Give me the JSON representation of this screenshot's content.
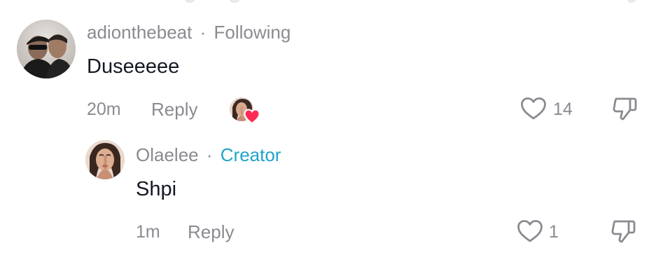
{
  "comments": [
    {
      "username": "adionthebeat",
      "separator": "·",
      "relation": "Following",
      "text": "Duseeeee",
      "time": "20m",
      "reply_label": "Reply",
      "likes": "14",
      "creator_liked": true
    },
    {
      "username": "Olaelee",
      "separator": "·",
      "relation": "Creator",
      "text": "Shpi",
      "time": "1m",
      "reply_label": "Reply",
      "likes": "1"
    }
  ],
  "icons": {
    "like": "heart-outline-icon",
    "dislike": "thumbs-down-icon",
    "creator_like_badge": "red-heart-icon"
  },
  "colors": {
    "muted": "#8a8b91",
    "text": "#161823",
    "creator": "#20a3c8",
    "heart_badge": "#fe2c55"
  }
}
